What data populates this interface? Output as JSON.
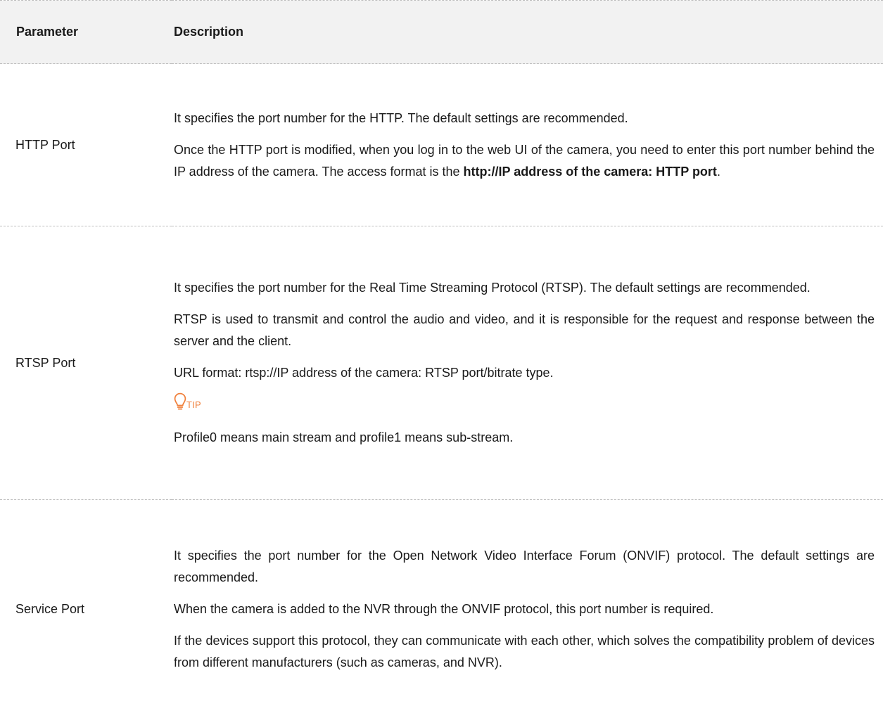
{
  "table": {
    "headers": {
      "parameter": "Parameter",
      "description": "Description"
    },
    "rows": [
      {
        "name": "HTTP Port",
        "p1": "It specifies the port number for the HTTP. The default settings are recommended.",
        "p2": "Once the HTTP port is modified, when you log in to the web UI of the camera, you need to enter this port number behind the IP address of the camera. The access format is the ",
        "p2_bold": "http://IP address of the camera: HTTP port",
        "p2_end": "."
      },
      {
        "name": "RTSP Port",
        "p1": "It specifies the port number for the Real Time Streaming Protocol (RTSP). The default settings are recommended.",
        "p2": "RTSP is used to transmit and control the audio and video, and it is responsible for the request and response between the server and the client.",
        "p3": "URL format: rtsp://IP address of the camera: RTSP port/bitrate type.",
        "tip_label": "TIP",
        "p4": "Profile0 means main stream and profile1 means sub-stream."
      },
      {
        "name": "Service Port",
        "p1": "It specifies the port number for the Open Network Video Interface Forum (ONVIF) protocol. The default settings are recommended.",
        "p2": "When the camera is added to the NVR through the ONVIF protocol, this port number is required.",
        "p3": "If the devices support this protocol, they can communicate with each other, which solves the compatibility problem of devices from different manufacturers (such as cameras, and NVR)."
      }
    ]
  },
  "icons": {
    "tip": "lightbulb-icon"
  },
  "colors": {
    "header_bg": "#f2f2f2",
    "tip_accent": "#f07f3a",
    "divider": "#bdbdbd"
  }
}
